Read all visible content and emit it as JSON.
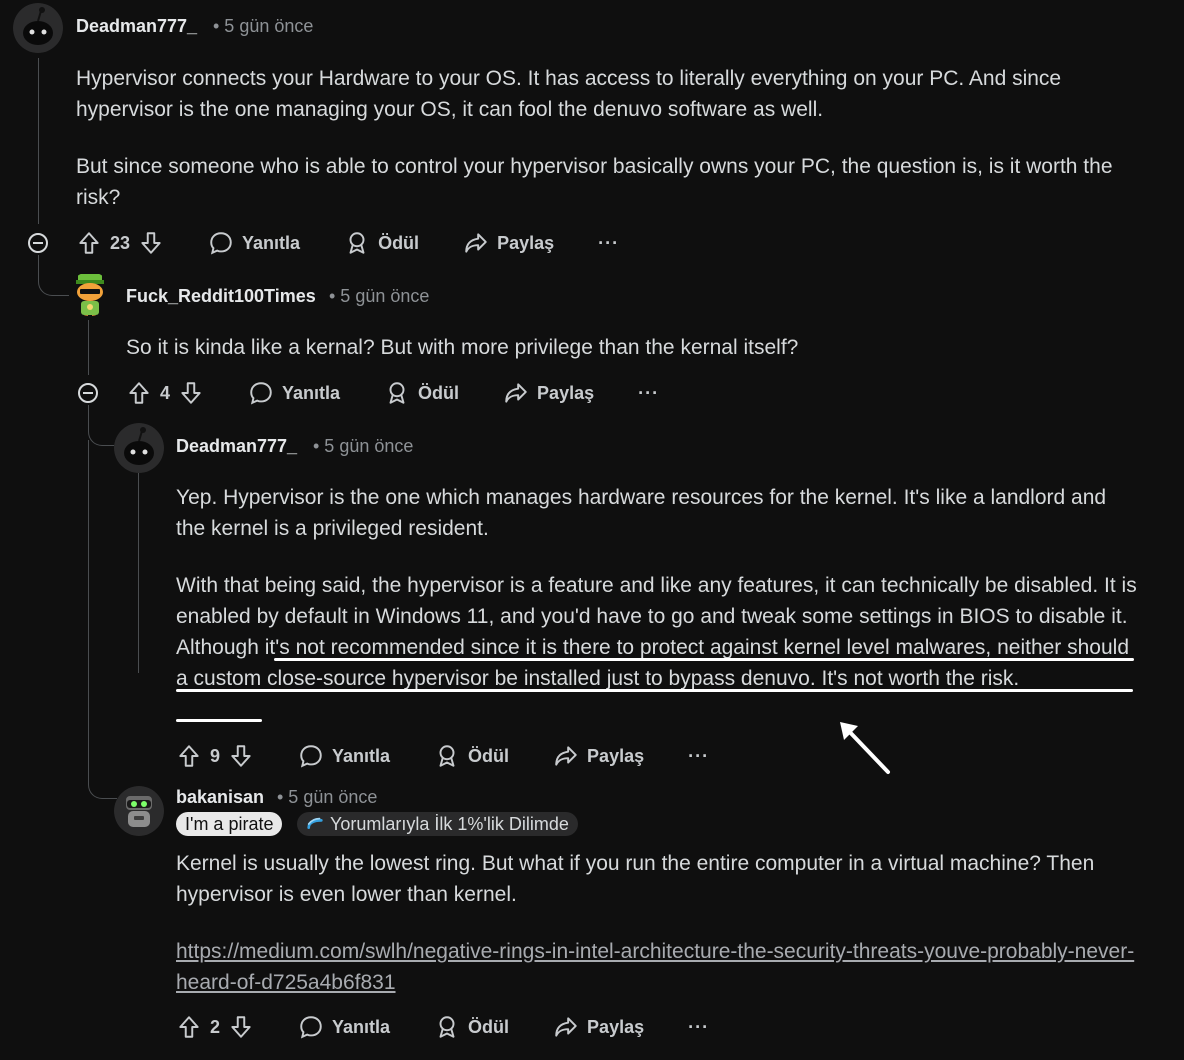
{
  "comments": [
    {
      "username": "Deadman777_",
      "time": "• 5 gün önce",
      "paragraphs": [
        "Hypervisor connects your Hardware to your OS. It has access to literally everything on your PC. And since hypervisor is the one managing your OS, it can fool the denuvo software as well.",
        "But since someone who is able to control your hypervisor basically owns your PC, the question is, is it worth the risk?"
      ],
      "votes": "23"
    },
    {
      "username": "Fuck_Reddit100Times",
      "time": "• 5 gün önce",
      "paragraphs": [
        "So it is kinda like a kernal? But with more privilege than the kernal itself?"
      ],
      "votes": "4"
    },
    {
      "username": "Deadman777_",
      "time": "• 5 gün önce",
      "paragraphs": [
        "Yep. Hypervisor is the one which manages hardware resources for the kernel. It's like a landlord and the kernel is a privileged resident.",
        "With that being said, the hypervisor is a feature and like any features, it can technically be disabled. It is enabled by default in Windows 11, and you'd have to go and tweak some settings in BIOS to disable it. Although it's not recommended since it is there to protect against kernel level malwares, neither should a custom close-source hypervisor be installed just to bypass denuvo. It's not worth the risk."
      ],
      "votes": "9"
    },
    {
      "username": "bakanisan",
      "time": "• 5 gün önce",
      "flair_1": "I'm a pirate",
      "flair_2": "Yorumlarıyla İlk 1%'lik Dilimde",
      "paragraphs": [
        "Kernel is usually the lowest ring. But what if you run the entire computer in a virtual machine? Then hypervisor is even lower than kernel."
      ],
      "link": "https://medium.com/swlh/negative-rings-in-intel-architecture-the-security-threats-youve-probably-never-heard-of-d725a4b6f831",
      "votes": "2"
    }
  ],
  "actions": {
    "reply": "Yanıtla",
    "award": "Ödül",
    "share": "Paylaş",
    "more": "···"
  },
  "colors": {
    "background": "#0f0f0f",
    "text": "#d7dadc",
    "muted": "#8e9296",
    "thread_line": "#4a4d50"
  }
}
